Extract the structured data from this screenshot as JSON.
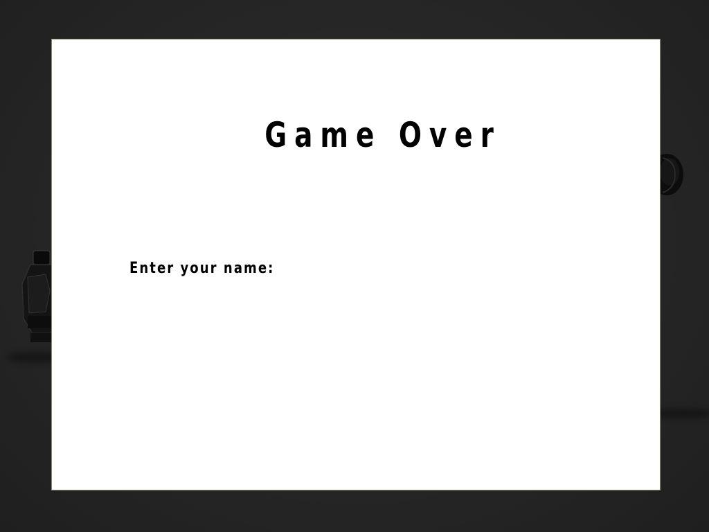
{
  "game_over_dialog": {
    "title": "Game Over",
    "name_prompt": "Enter your name:",
    "name_value": ""
  },
  "colors": {
    "background": "#262626",
    "dialog_background": "#ffffff",
    "text": "#000000"
  }
}
